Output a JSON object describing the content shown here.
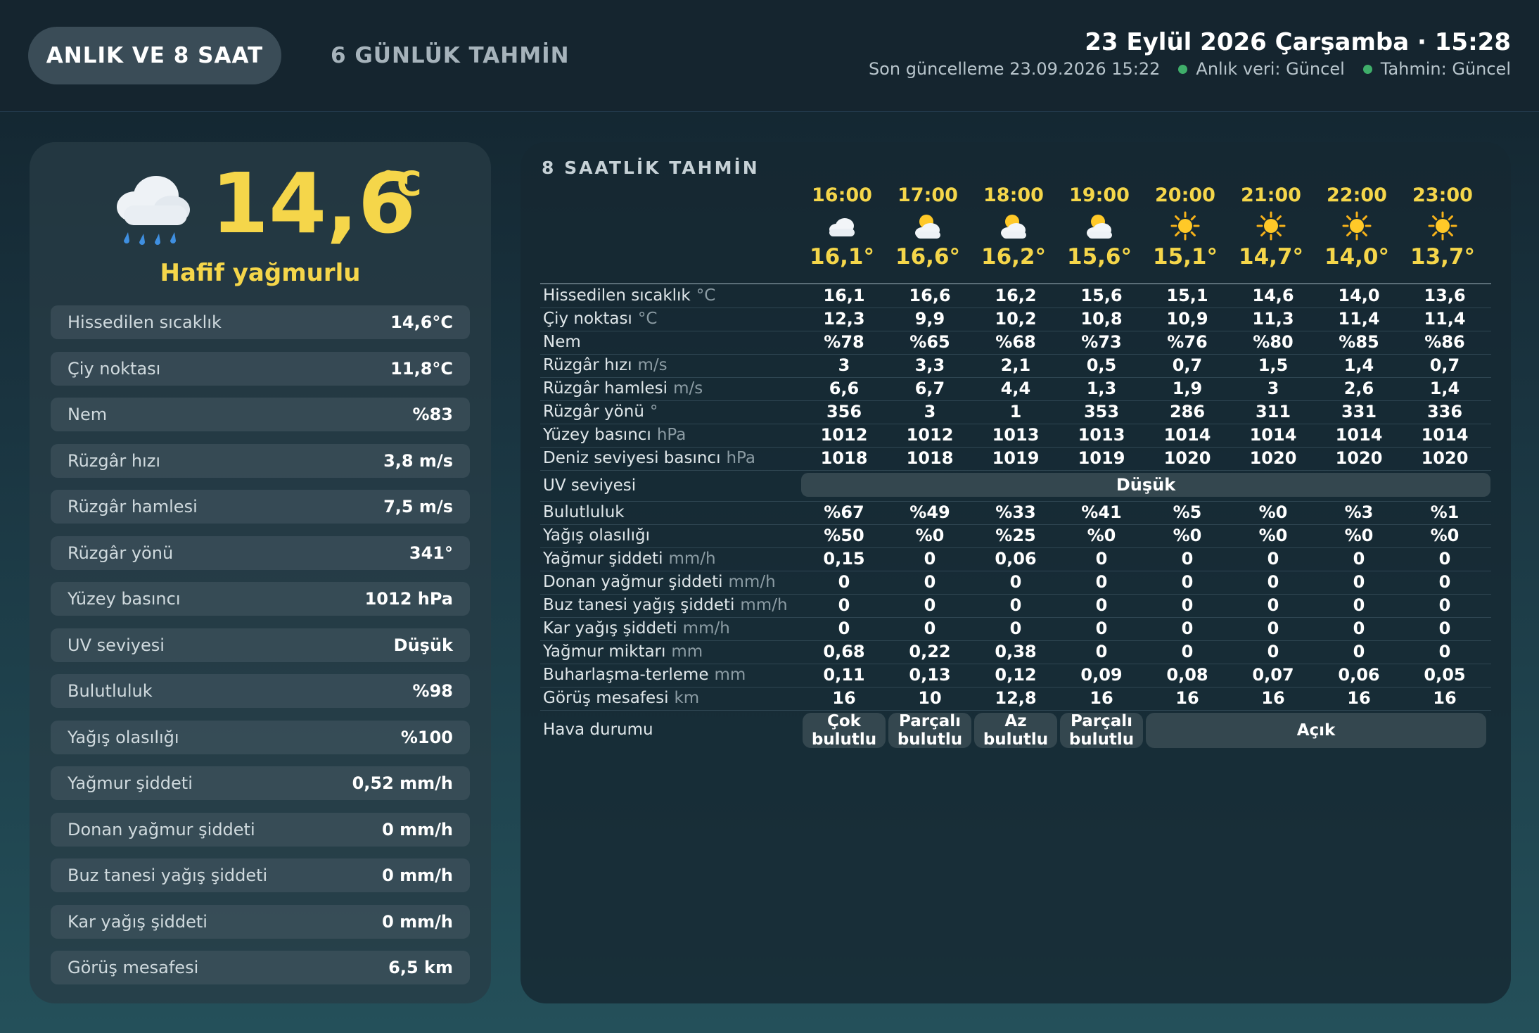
{
  "tabs": {
    "now": "ANLIK VE 8 SAAT",
    "forecast": "6 GÜNLÜK TAHMİN"
  },
  "header": {
    "datetime": "23 Eylül 2026 Çarşamba · 15:28",
    "last_update": "Son güncelleme 23.09.2026 15:22",
    "live_status": "Anlık veri: Güncel",
    "forecast_status": "Tahmin: Güncel",
    "status_color": "#3fae6a"
  },
  "current": {
    "temp": "14,6",
    "unit": "°C",
    "condition": "Hafif yağmurlu",
    "icon": "rain-cloud-icon",
    "metrics": [
      {
        "label": "Hissedilen sıcaklık",
        "value": "14,6°C"
      },
      {
        "label": "Çiy noktası",
        "value": "11,8°C"
      },
      {
        "label": "Nem",
        "value": "%83"
      },
      {
        "label": "Rüzgâr hızı",
        "value": "3,8 m/s"
      },
      {
        "label": "Rüzgâr hamlesi",
        "value": "7,5 m/s"
      },
      {
        "label": "Rüzgâr yönü",
        "value": "341°"
      },
      {
        "label": "Yüzey basıncı",
        "value": "1012 hPa"
      },
      {
        "label": "UV seviyesi",
        "value": "Düşük"
      },
      {
        "label": "Bulutluluk",
        "value": "%98"
      },
      {
        "label": "Yağış olasılığı",
        "value": "%100"
      },
      {
        "label": "Yağmur şiddeti",
        "value": "0,52 mm/h"
      },
      {
        "label": "Donan yağmur şiddeti",
        "value": "0 mm/h"
      },
      {
        "label": "Buz tanesi yağış şiddeti",
        "value": "0 mm/h"
      },
      {
        "label": "Kar yağış şiddeti",
        "value": "0 mm/h"
      },
      {
        "label": "Görüş mesafesi",
        "value": "6,5 km"
      }
    ]
  },
  "forecast": {
    "title": "8 SAATLİK TAHMİN",
    "hours": [
      {
        "time": "16:00",
        "temp": "16,1°",
        "icon": "cloud-icon"
      },
      {
        "time": "17:00",
        "temp": "16,6°",
        "icon": "sun-behind-cloud-icon"
      },
      {
        "time": "18:00",
        "temp": "16,2°",
        "icon": "sun-behind-cloud-icon"
      },
      {
        "time": "19:00",
        "temp": "15,6°",
        "icon": "sun-behind-cloud-icon"
      },
      {
        "time": "20:00",
        "temp": "15,1°",
        "icon": "sun-icon"
      },
      {
        "time": "21:00",
        "temp": "14,7°",
        "icon": "sun-icon"
      },
      {
        "time": "22:00",
        "temp": "14,0°",
        "icon": "sun-icon"
      },
      {
        "time": "23:00",
        "temp": "13,7°",
        "icon": "sun-icon"
      }
    ],
    "rows_top": [
      {
        "label": "Hissedilen sıcaklık",
        "unit": "°C",
        "values": [
          "16,1",
          "16,6",
          "16,2",
          "15,6",
          "15,1",
          "14,6",
          "14,0",
          "13,6"
        ]
      },
      {
        "label": "Çiy noktası",
        "unit": "°C",
        "values": [
          "12,3",
          "9,9",
          "10,2",
          "10,8",
          "10,9",
          "11,3",
          "11,4",
          "11,4"
        ]
      },
      {
        "label": "Nem",
        "unit": "",
        "values": [
          "%78",
          "%65",
          "%68",
          "%73",
          "%76",
          "%80",
          "%85",
          "%86"
        ]
      },
      {
        "label": "Rüzgâr hızı",
        "unit": "m/s",
        "values": [
          "3",
          "3,3",
          "2,1",
          "0,5",
          "0,7",
          "1,5",
          "1,4",
          "0,7"
        ]
      },
      {
        "label": "Rüzgâr hamlesi",
        "unit": "m/s",
        "values": [
          "6,6",
          "6,7",
          "4,4",
          "1,3",
          "1,9",
          "3",
          "2,6",
          "1,4"
        ]
      },
      {
        "label": "Rüzgâr yönü",
        "unit": "°",
        "values": [
          "356",
          "3",
          "1",
          "353",
          "286",
          "311",
          "331",
          "336"
        ]
      },
      {
        "label": "Yüzey basıncı",
        "unit": "hPa",
        "values": [
          "1012",
          "1012",
          "1013",
          "1013",
          "1014",
          "1014",
          "1014",
          "1014"
        ]
      },
      {
        "label": "Deniz seviyesi basıncı",
        "unit": "hPa",
        "values": [
          "1018",
          "1018",
          "1019",
          "1019",
          "1020",
          "1020",
          "1020",
          "1020"
        ]
      }
    ],
    "uv": {
      "label": "UV seviyesi",
      "value": "Düşük"
    },
    "rows_bottom": [
      {
        "label": "Bulutluluk",
        "unit": "",
        "values": [
          "%67",
          "%49",
          "%33",
          "%41",
          "%5",
          "%0",
          "%3",
          "%1"
        ]
      },
      {
        "label": "Yağış olasılığı",
        "unit": "",
        "values": [
          "%50",
          "%0",
          "%25",
          "%0",
          "%0",
          "%0",
          "%0",
          "%0"
        ]
      },
      {
        "label": "Yağmur şiddeti",
        "unit": "mm/h",
        "values": [
          "0,15",
          "0",
          "0,06",
          "0",
          "0",
          "0",
          "0",
          "0"
        ]
      },
      {
        "label": "Donan yağmur şiddeti",
        "unit": "mm/h",
        "values": [
          "0",
          "0",
          "0",
          "0",
          "0",
          "0",
          "0",
          "0"
        ]
      },
      {
        "label": "Buz tanesi yağış şiddeti",
        "unit": "mm/h",
        "values": [
          "0",
          "0",
          "0",
          "0",
          "0",
          "0",
          "0",
          "0"
        ]
      },
      {
        "label": "Kar yağış şiddeti",
        "unit": "mm/h",
        "values": [
          "0",
          "0",
          "0",
          "0",
          "0",
          "0",
          "0",
          "0"
        ]
      },
      {
        "label": "Yağmur miktarı",
        "unit": "mm",
        "values": [
          "0,68",
          "0,22",
          "0,38",
          "0",
          "0",
          "0",
          "0",
          "0"
        ]
      },
      {
        "label": "Buharlaşma-terleme",
        "unit": "mm",
        "values": [
          "0,11",
          "0,13",
          "0,12",
          "0,09",
          "0,08",
          "0,07",
          "0,06",
          "0,05"
        ]
      },
      {
        "label": "Görüş mesafesi",
        "unit": "km",
        "values": [
          "16",
          "10",
          "12,8",
          "16",
          "16",
          "16",
          "16",
          "16"
        ]
      }
    ],
    "condition": {
      "label": "Hava durumu",
      "groups": [
        {
          "text": "Çok bulutlu",
          "span": 1
        },
        {
          "text": "Parçalı bulutlu",
          "span": 1
        },
        {
          "text": "Az bulutlu",
          "span": 1
        },
        {
          "text": "Parçalı bulutlu",
          "span": 1
        },
        {
          "text": "Açık",
          "span": 4
        }
      ]
    },
    "colors": {
      "accent": "#f5d64a"
    }
  }
}
